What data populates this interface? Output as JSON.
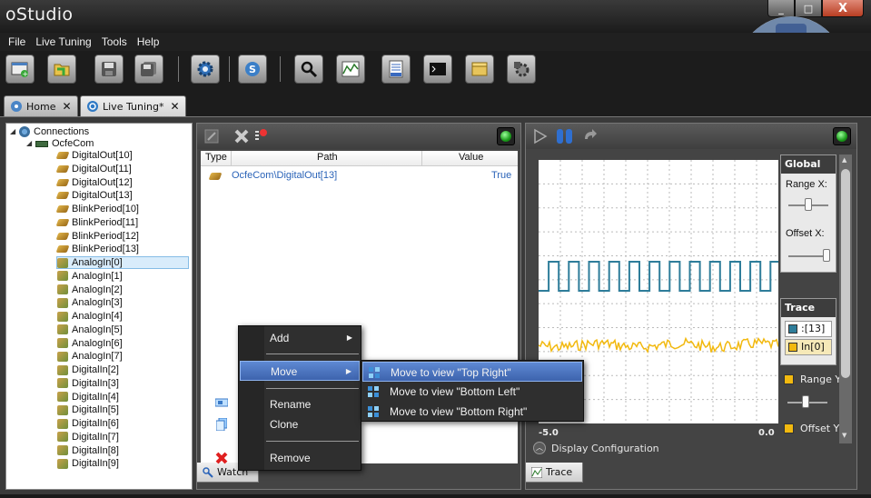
{
  "app": {
    "title": "oStudio",
    "window_buttons": {
      "minimize": "_",
      "maximize": "□",
      "close": "X"
    }
  },
  "menu": [
    "File",
    "Live Tuning",
    "Tools",
    "Help"
  ],
  "toolbar_icons": [
    "new-project-icon",
    "open-folder-icon",
    "save-icon",
    "save-all-icon",
    "settings-gear-icon",
    "connection-icon",
    "search-icon",
    "chart-icon",
    "log-icon",
    "terminal-icon",
    "package-icon",
    "plugin-icon"
  ],
  "tabs": [
    {
      "label": "Home",
      "close": "✕",
      "icon": "home-icon"
    },
    {
      "label": "Live Tuning*",
      "close": "✕",
      "icon": "live-tuning-icon"
    }
  ],
  "tree": {
    "root": "Connections",
    "device": "OcfeCom",
    "items": [
      {
        "label": "DigitalOut[10]",
        "type": "out"
      },
      {
        "label": "DigitalOut[11]",
        "type": "out"
      },
      {
        "label": "DigitalOut[12]",
        "type": "out"
      },
      {
        "label": "DigitalOut[13]",
        "type": "out"
      },
      {
        "label": "BlinkPeriod[10]",
        "type": "out"
      },
      {
        "label": "BlinkPeriod[11]",
        "type": "out"
      },
      {
        "label": "BlinkPeriod[12]",
        "type": "out"
      },
      {
        "label": "BlinkPeriod[13]",
        "type": "out"
      },
      {
        "label": "AnalogIn[0]",
        "type": "in",
        "selected": true
      },
      {
        "label": "AnalogIn[1]",
        "type": "in"
      },
      {
        "label": "AnalogIn[2]",
        "type": "in"
      },
      {
        "label": "AnalogIn[3]",
        "type": "in"
      },
      {
        "label": "AnalogIn[4]",
        "type": "in"
      },
      {
        "label": "AnalogIn[5]",
        "type": "in"
      },
      {
        "label": "AnalogIn[6]",
        "type": "in"
      },
      {
        "label": "AnalogIn[7]",
        "type": "in"
      },
      {
        "label": "DigitalIn[2]",
        "type": "in"
      },
      {
        "label": "DigitalIn[3]",
        "type": "in"
      },
      {
        "label": "DigitalIn[4]",
        "type": "in"
      },
      {
        "label": "DigitalIn[5]",
        "type": "in"
      },
      {
        "label": "DigitalIn[6]",
        "type": "in"
      },
      {
        "label": "DigitalIn[7]",
        "type": "in"
      },
      {
        "label": "DigitalIn[8]",
        "type": "in"
      },
      {
        "label": "DigitalIn[9]",
        "type": "in"
      }
    ]
  },
  "watch": {
    "columns": {
      "type": "Type",
      "path": "Path",
      "value": "Value"
    },
    "rows": [
      {
        "path": "OcfeCom\\DigitalOut[13]",
        "value": "True"
      }
    ],
    "tab_label": "Watch"
  },
  "trace": {
    "x_min_label": "-5.0",
    "x_max_label": "0.0",
    "global": {
      "title": "Global",
      "range_x": "Range X:",
      "offset_x": "Offset X:"
    },
    "trace_box": {
      "title": "Trace",
      "entries": [
        ":[13]",
        "In[0]"
      ]
    },
    "range_label": "Range Y",
    "offset_label": "Offset Y",
    "display_config": "Display Configuration",
    "tab_label": "Trace",
    "colors": {
      "digital": "#2e7d9a",
      "analog": "#f2b90f"
    }
  },
  "context_menu": {
    "items": [
      "Add",
      "Move",
      "Rename",
      "Clone",
      "Remove"
    ],
    "submenu": [
      "Move to view \"Top Right\"",
      "Move to view \"Bottom Left\"",
      "Move to view \"Bottom Right\""
    ]
  }
}
